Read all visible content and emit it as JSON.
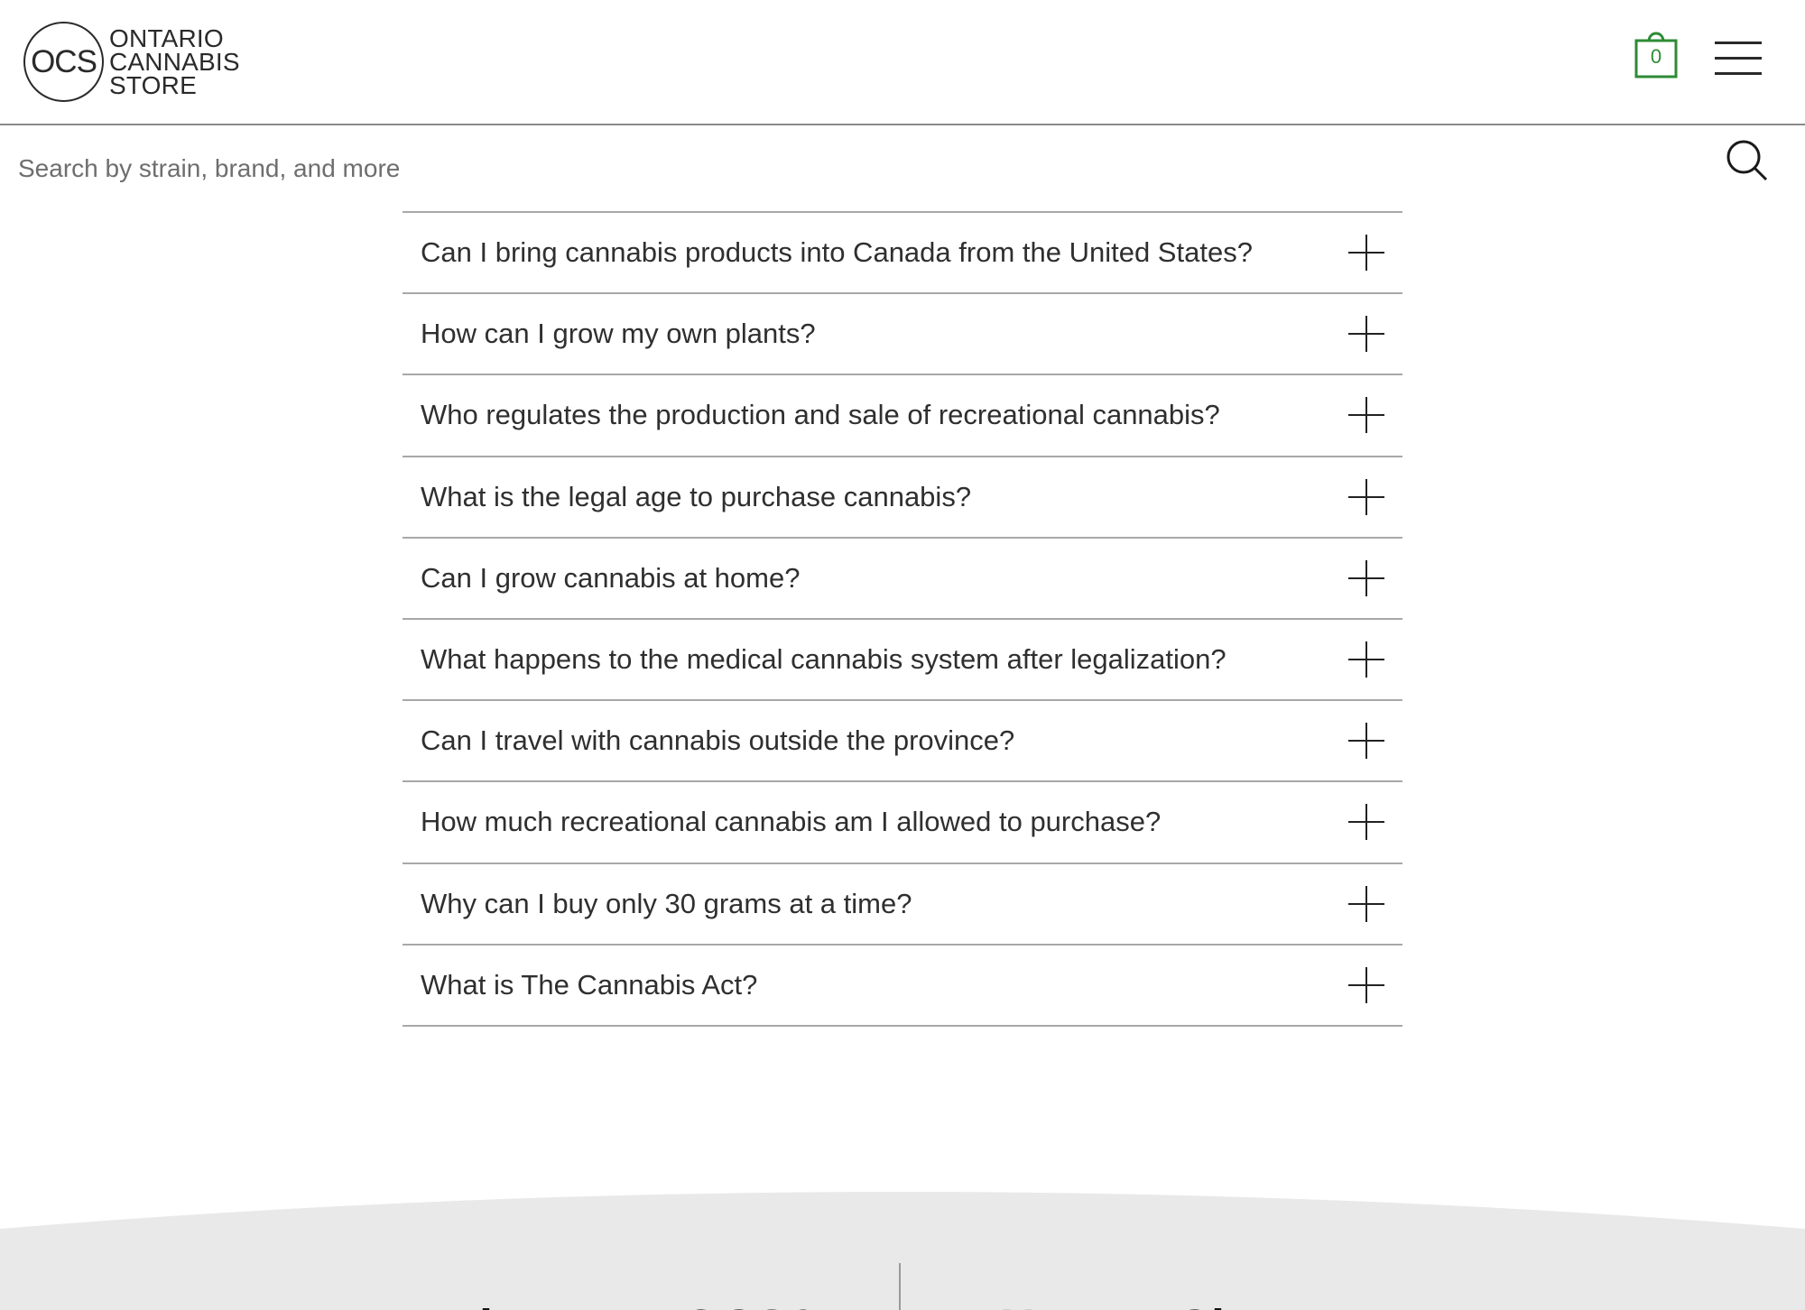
{
  "header": {
    "logo_mark": "OCS",
    "logo_line1": "ONTARIO",
    "logo_line2": "CANNABIS",
    "logo_line3": "STORE",
    "cart_count": "0",
    "accent_color": "#2e8b35"
  },
  "search": {
    "placeholder": "Search by strain, brand, and more"
  },
  "faq": {
    "items": [
      "Can I bring cannabis products into Canada from the United States?",
      "How can I grow my own plants?",
      "Who regulates the production and sale of recreational cannabis?",
      "What is the legal age to purchase cannabis?",
      "Can I grow cannabis at home?",
      "What happens to the medical cannabis system after legalization?",
      "Can I travel with cannabis outside the province?",
      "How much recreational cannabis am I allowed to purchase?",
      "Why can I buy only 30 grams at a time?",
      "What is The Cannabis Act?"
    ]
  },
  "bottom": {
    "left_title": "Why Trust OCS?",
    "right_title": "How to Choose"
  }
}
